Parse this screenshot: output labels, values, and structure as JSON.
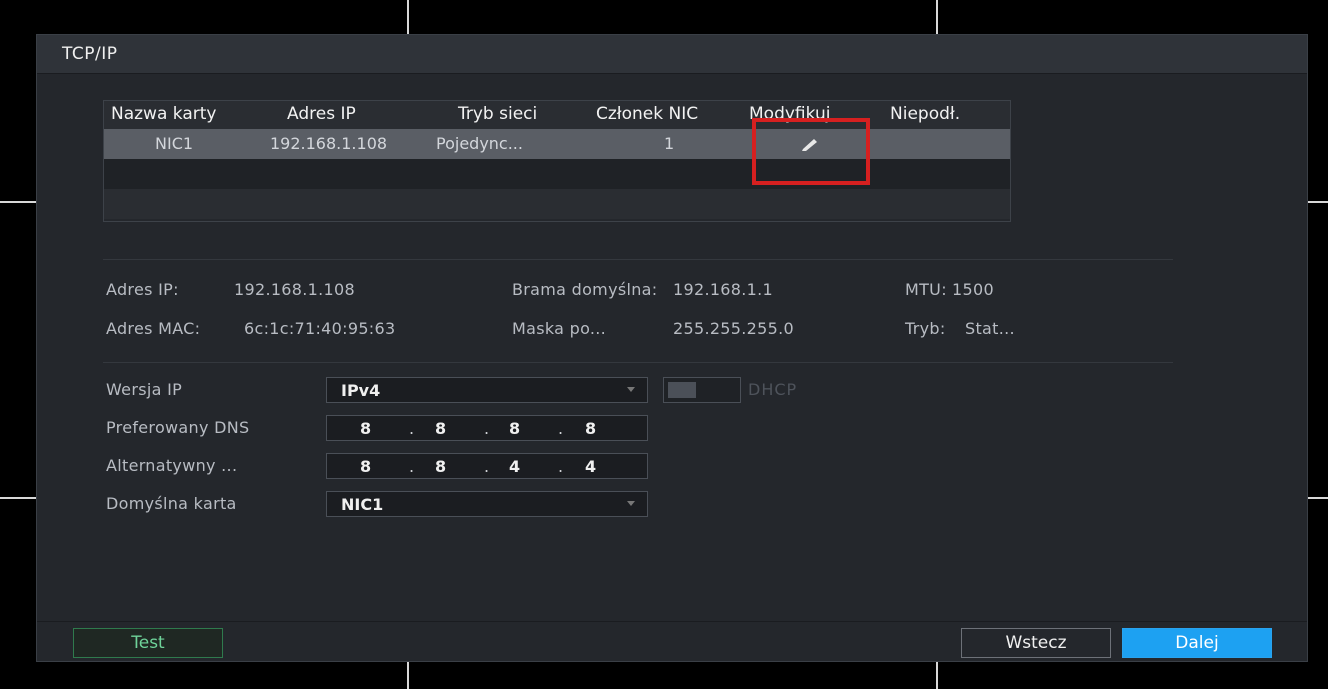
{
  "window": {
    "title": "TCP/IP"
  },
  "nic_table": {
    "headers": [
      "Nazwa karty",
      "Adres IP",
      "Tryb sieci",
      "Członek NIC",
      "Modyfikuj",
      "Niepodł."
    ],
    "rows": [
      {
        "name": "NIC1",
        "ip": "192.168.1.108",
        "mode": "Pojedync...",
        "member": "1",
        "edit_icon": "pencil-icon"
      }
    ]
  },
  "info": {
    "ip_label": "Adres IP:",
    "ip_value": "192.168.1.108",
    "gateway_label": "Brama domyślna:",
    "gateway_value": "192.168.1.1",
    "mtu_label": "MTU:",
    "mtu_value": "1500",
    "mac_label": "Adres MAC:",
    "mac_value": "6c:1c:71:40:95:63",
    "mask_label": "Maska po...",
    "mask_value": "255.255.255.0",
    "mode_label": "Tryb:",
    "mode_value": "Stat..."
  },
  "form": {
    "ip_version_label": "Wersja IP",
    "ip_version_value": "IPv4",
    "dhcp_label": "DHCP",
    "dhcp_enabled": false,
    "preferred_dns_label": "Preferowany DNS",
    "preferred_dns": [
      "8",
      "8",
      "8",
      "8"
    ],
    "alternate_dns_label": "Alternatywny ...",
    "alternate_dns": [
      "8",
      "8",
      "4",
      "4"
    ],
    "default_card_label": "Domyślna karta",
    "default_card_value": "NIC1"
  },
  "footer": {
    "test_label": "Test",
    "back_label": "Wstecz",
    "next_label": "Dalej"
  },
  "colors": {
    "accent": "#1da1f2",
    "highlight_box": "#d62020",
    "test_green": "#6fd39a"
  }
}
